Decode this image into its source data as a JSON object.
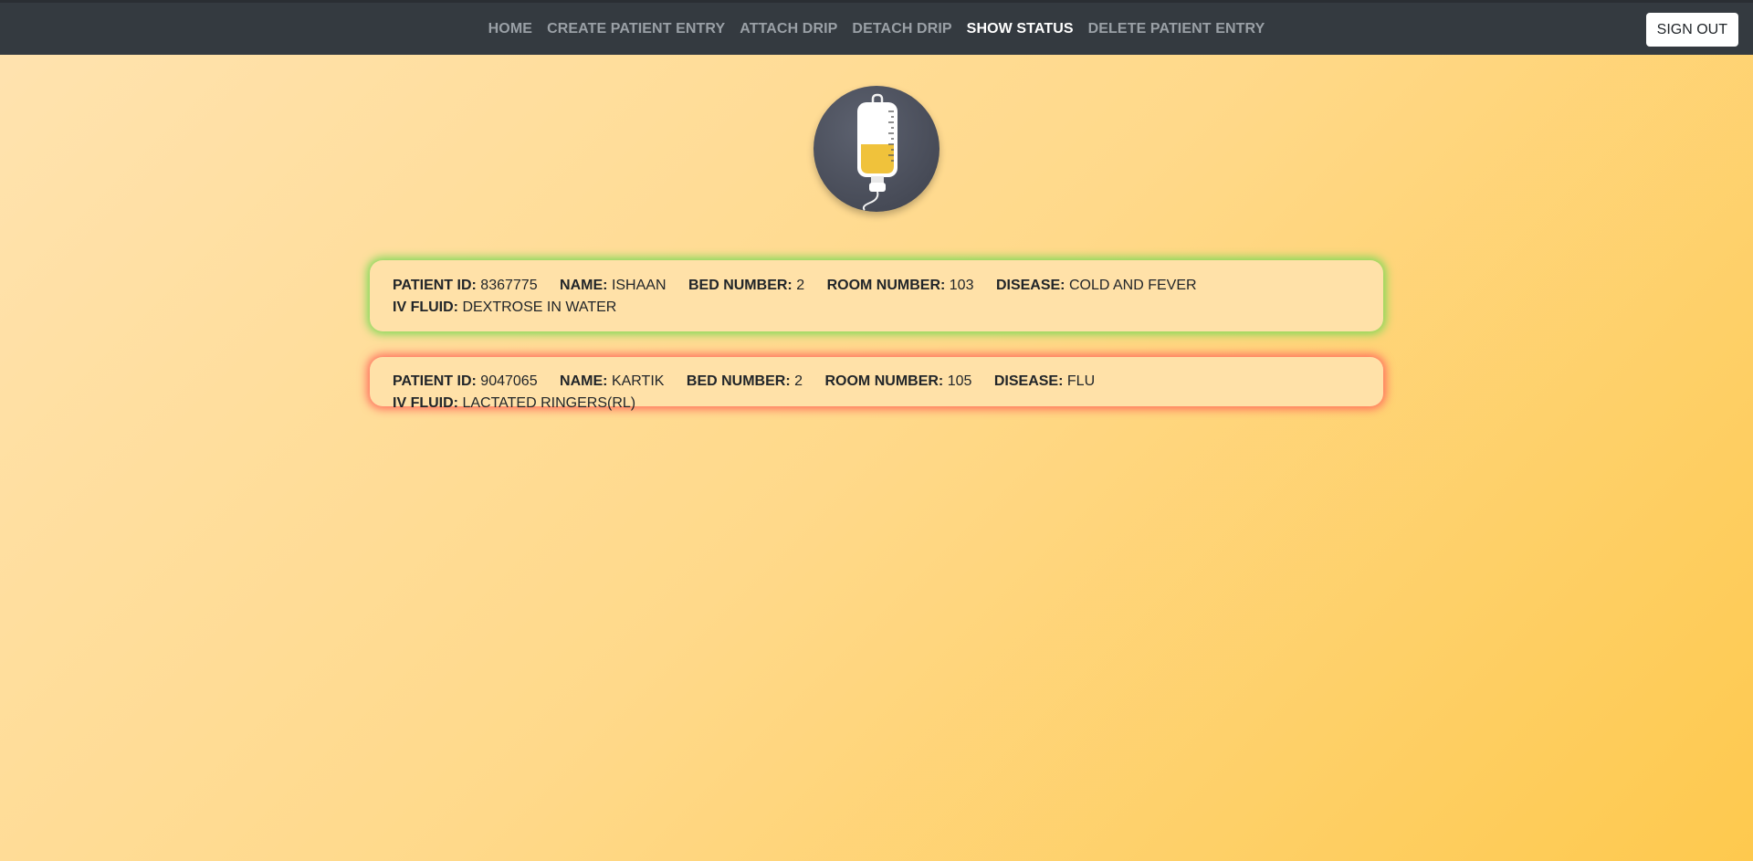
{
  "nav": {
    "items": [
      {
        "label": "HOME"
      },
      {
        "label": "CREATE PATIENT ENTRY"
      },
      {
        "label": "ATTACH DRIP"
      },
      {
        "label": "DETACH DRIP"
      },
      {
        "label": "SHOW STATUS"
      },
      {
        "label": "DELETE PATIENT ENTRY"
      }
    ],
    "active": "SHOW STATUS",
    "signout_label": "SIGN OUT"
  },
  "labels": {
    "patient_id": "PATIENT ID:",
    "name": "NAME:",
    "bed_number": "BED NUMBER:",
    "room_number": "ROOM NUMBER:",
    "disease": "DISEASE:",
    "iv_fluid": "IV FLUID:"
  },
  "patients": [
    {
      "patient_id": "8367775",
      "name": "ISHAAN",
      "bed_number": "2",
      "room_number": "103",
      "disease": "COLD AND FEVER",
      "iv_fluid": "DEXTROSE IN WATER",
      "status_color": "#7ed957"
    },
    {
      "patient_id": "9047065",
      "name": "KARTIK",
      "bed_number": "2",
      "room_number": "105",
      "disease": "FLU",
      "iv_fluid": "LACTATED RINGERS(RL)",
      "status_color": "#ff6b5b"
    }
  ],
  "logo": {
    "icon": "iv-drip-bag-icon",
    "fill_level": 0.35,
    "fluid_color": "#f0c23b"
  },
  "colors": {
    "navbar": "#343a40",
    "background_start": "#ffe3b0",
    "background_end": "#fec94e",
    "card_bg": "#ffe1a8"
  }
}
